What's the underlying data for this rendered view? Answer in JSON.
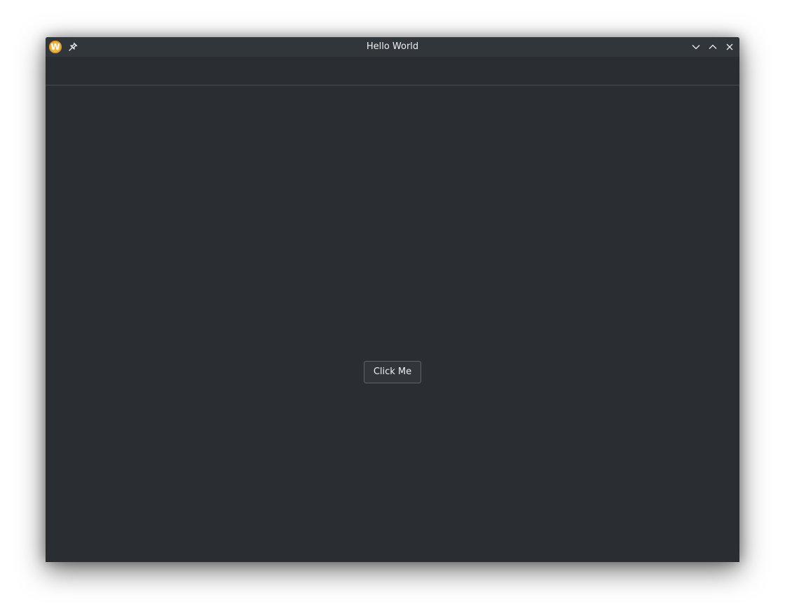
{
  "window": {
    "title": "Hello World",
    "app_icon_letter": "W"
  },
  "titlebar_buttons": {
    "minimize_icon": "chevron-down-icon",
    "maximize_icon": "chevron-up-icon",
    "close_icon": "close-icon"
  },
  "main": {
    "button_label": "Click Me"
  },
  "colors": {
    "window_bg": "#2a2d32",
    "titlebar_bg": "#31363b",
    "app_icon": "#f2b53a",
    "text": "#eff0f1"
  }
}
